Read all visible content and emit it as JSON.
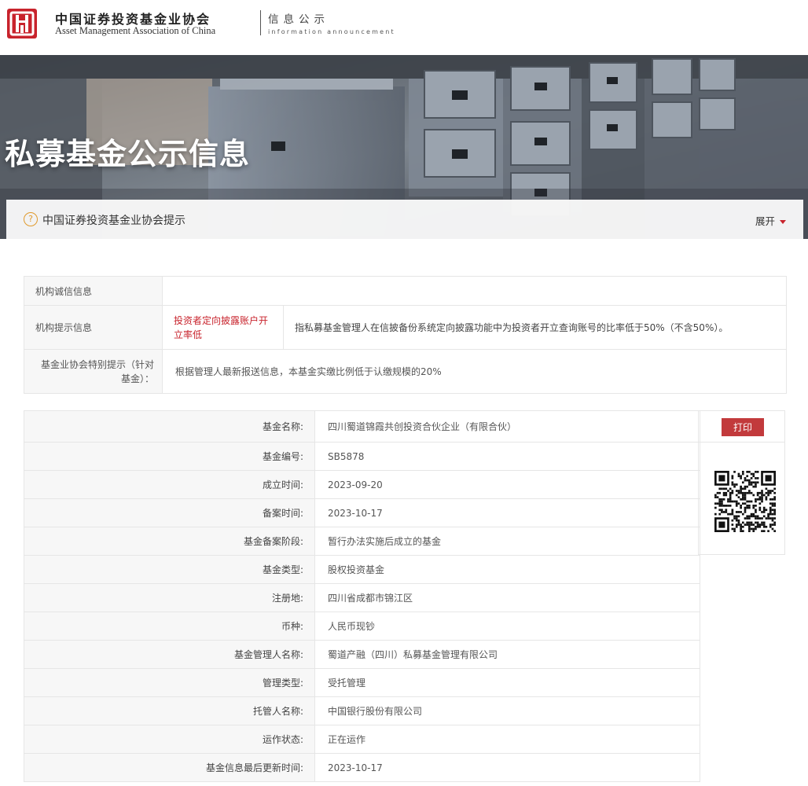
{
  "header": {
    "brand_cn": "中国证券投资基金业协会",
    "brand_en": "Asset Management Association of China",
    "section_cn": "信息公示",
    "section_en": "information announcement"
  },
  "banner": {
    "title": "私募基金公示信息"
  },
  "notice": {
    "help_symbol": "?",
    "text": "中国证券投资基金业协会提示",
    "expand_label": "展开",
    "expand_icon": "caret-down-icon",
    "accent_color": "#c8232c"
  },
  "credit": {
    "integrity_label": "机构诚信信息",
    "integrity_value": "",
    "hint_label": "机构提示信息",
    "hint_tag": "投资者定向披露账户开立率低",
    "hint_desc": "指私募基金管理人在信披备份系统定向披露功能中为投资者开立查询账号的比率低于50%（不含50%）。",
    "special_label": "基金业协会特别提示（针对基金）：",
    "special_value": "根据管理人最新报送信息，本基金实缴比例低于认缴规模的20%"
  },
  "fund": {
    "rows": [
      {
        "label": "基金名称:",
        "value": "四川蜀道锦霞共创投资合伙企业（有限合伙）"
      },
      {
        "label": "基金编号:",
        "value": "SB5878"
      },
      {
        "label": "成立时间:",
        "value": "2023-09-20"
      },
      {
        "label": "备案时间:",
        "value": "2023-10-17"
      },
      {
        "label": "基金备案阶段:",
        "value": "暂行办法实施后成立的基金"
      },
      {
        "label": "基金类型:",
        "value": "股权投资基金"
      },
      {
        "label": "注册地:",
        "value": "四川省成都市锦江区"
      },
      {
        "label": "币种:",
        "value": "人民币现钞"
      },
      {
        "label": "基金管理人名称:",
        "value": "蜀道产融（四川）私募基金管理有限公司"
      },
      {
        "label": "管理类型:",
        "value": "受托管理"
      },
      {
        "label": "托管人名称:",
        "value": "中国银行股份有限公司"
      },
      {
        "label": "运作状态:",
        "value": "正在运作"
      },
      {
        "label": "基金信息最后更新时间:",
        "value": "2023-10-17"
      }
    ],
    "print_label": "打印",
    "print_color": "#c23a3c",
    "qr_icon": "qr-code-icon"
  }
}
